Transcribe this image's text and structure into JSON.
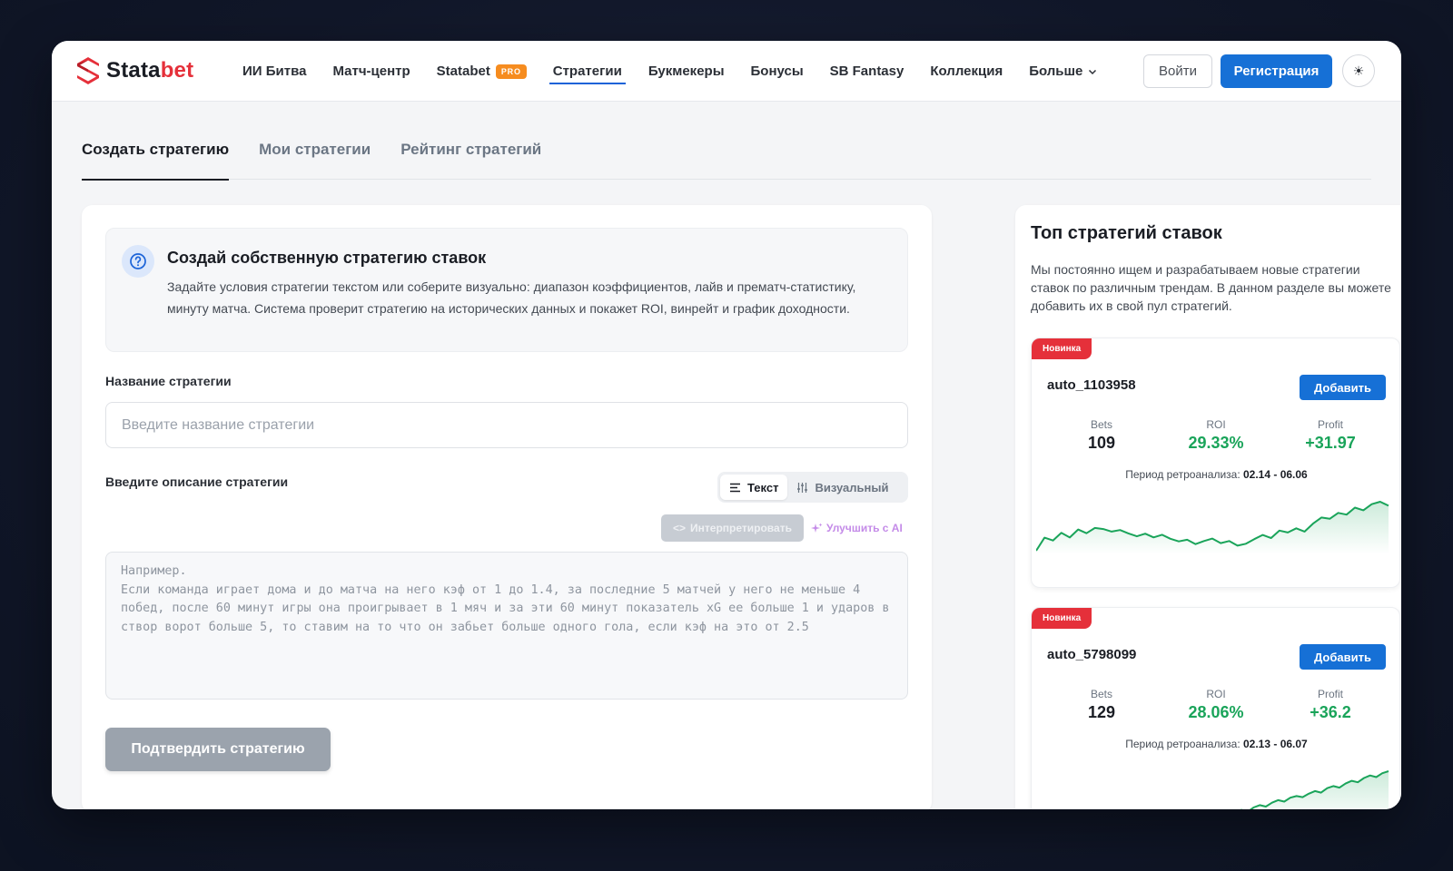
{
  "brand": {
    "logo_plain": "Stata",
    "logo_accent": "bet",
    "accent_color": "#e5303a"
  },
  "nav": {
    "items": [
      {
        "label": "ИИ Битва"
      },
      {
        "label": "Матч-центр"
      },
      {
        "label": "Statabet",
        "badge": "PRO"
      },
      {
        "label": "Стратегии",
        "active": true
      },
      {
        "label": "Букмекеры"
      },
      {
        "label": "Бонусы"
      },
      {
        "label": "SB Fantasy"
      },
      {
        "label": "Коллекция"
      },
      {
        "label": "Больше"
      }
    ],
    "login": "Войти",
    "register": "Регистрация",
    "theme_icon": "☀"
  },
  "tabs": [
    {
      "label": "Создать стратегию",
      "active": true
    },
    {
      "label": "Мои стратегии"
    },
    {
      "label": "Рейтинг стратегий"
    }
  ],
  "create": {
    "info_title": "Создай собственную стратегию ставок",
    "info_text": "Задайте условия стратегии текстом или соберите визуально: диапазон коэффициентов, лайв и прематч-статистику, минуту матча. Система проверит стратегию на исторических данных и покажет ROI, винрейт и график доходности.",
    "name_label": "Название стратегии",
    "name_placeholder": "Введите название стратегии",
    "desc_label": "Введите описание стратегии",
    "mode_text": "Текст",
    "mode_visual": "Визуальный",
    "interpret": "Интерпретировать",
    "improve_ai": "Улучшить с AI",
    "desc_placeholder": "Например.\nЕсли команда играет дома и до матча на него кэф от 1 до 1.4, за последние 5 матчей у него не меньше 4 побед, после 60 минут игры она проигрывает в 1 мяч и за эти 60 минут показатель xG ее больше 1 и ударов в створ ворот больше 5, то ставим на то что он забьет больше одного гола, если кэф на это от 2.5",
    "confirm": "Подтвердить стратегию"
  },
  "top": {
    "title": "Топ стратегий ставок",
    "description": "Мы постоянно ищем и разрабатываем новые стратегии ставок по различным трендам. В данном разделе вы можете добавить их в свой пул стратегий.",
    "badge": "Новинка",
    "add_label": "Добавить",
    "bets_label": "Bets",
    "roi_label": "ROI",
    "profit_label": "Profit",
    "period_label": "Период ретроанализа:",
    "cards": [
      {
        "name": "auto_1103958",
        "bets": "109",
        "roi": "29.33%",
        "profit": "+31.97",
        "period": "02.14 - 06.06",
        "trend": [
          1.0,
          8.5,
          6.9,
          11.3,
          8.6,
          13.2,
          11.1,
          14.1,
          13.5,
          12.0,
          12.9,
          11.0,
          9.3,
          10.8,
          8.7,
          10.2,
          7.9,
          6.4,
          7.3,
          4.8,
          6.6,
          8.0,
          5.4,
          6.6,
          3.9,
          5.0,
          7.7,
          10.1,
          8.3,
          12.6,
          11.5,
          13.9,
          12.0,
          16.6,
          20.1,
          19.4,
          22.8,
          21.8,
          25.8,
          24.3,
          27.8,
          29.2,
          26.9
        ]
      },
      {
        "name": "auto_5798099",
        "bets": "129",
        "roi": "28.06%",
        "profit": "+36.2",
        "period": "02.13 - 06.07",
        "trend": [
          0.0,
          1.5,
          3.2,
          5.8,
          4.6,
          7.1,
          8.4,
          7.6,
          9.8,
          11.2,
          10.4,
          12.6,
          13.5,
          12.9,
          14.8,
          16.3,
          15.4,
          17.9,
          19.1,
          18.2,
          20.5,
          22.0,
          21.2,
          23.6,
          25.0,
          24.1,
          26.3,
          27.4
        ]
      }
    ]
  }
}
